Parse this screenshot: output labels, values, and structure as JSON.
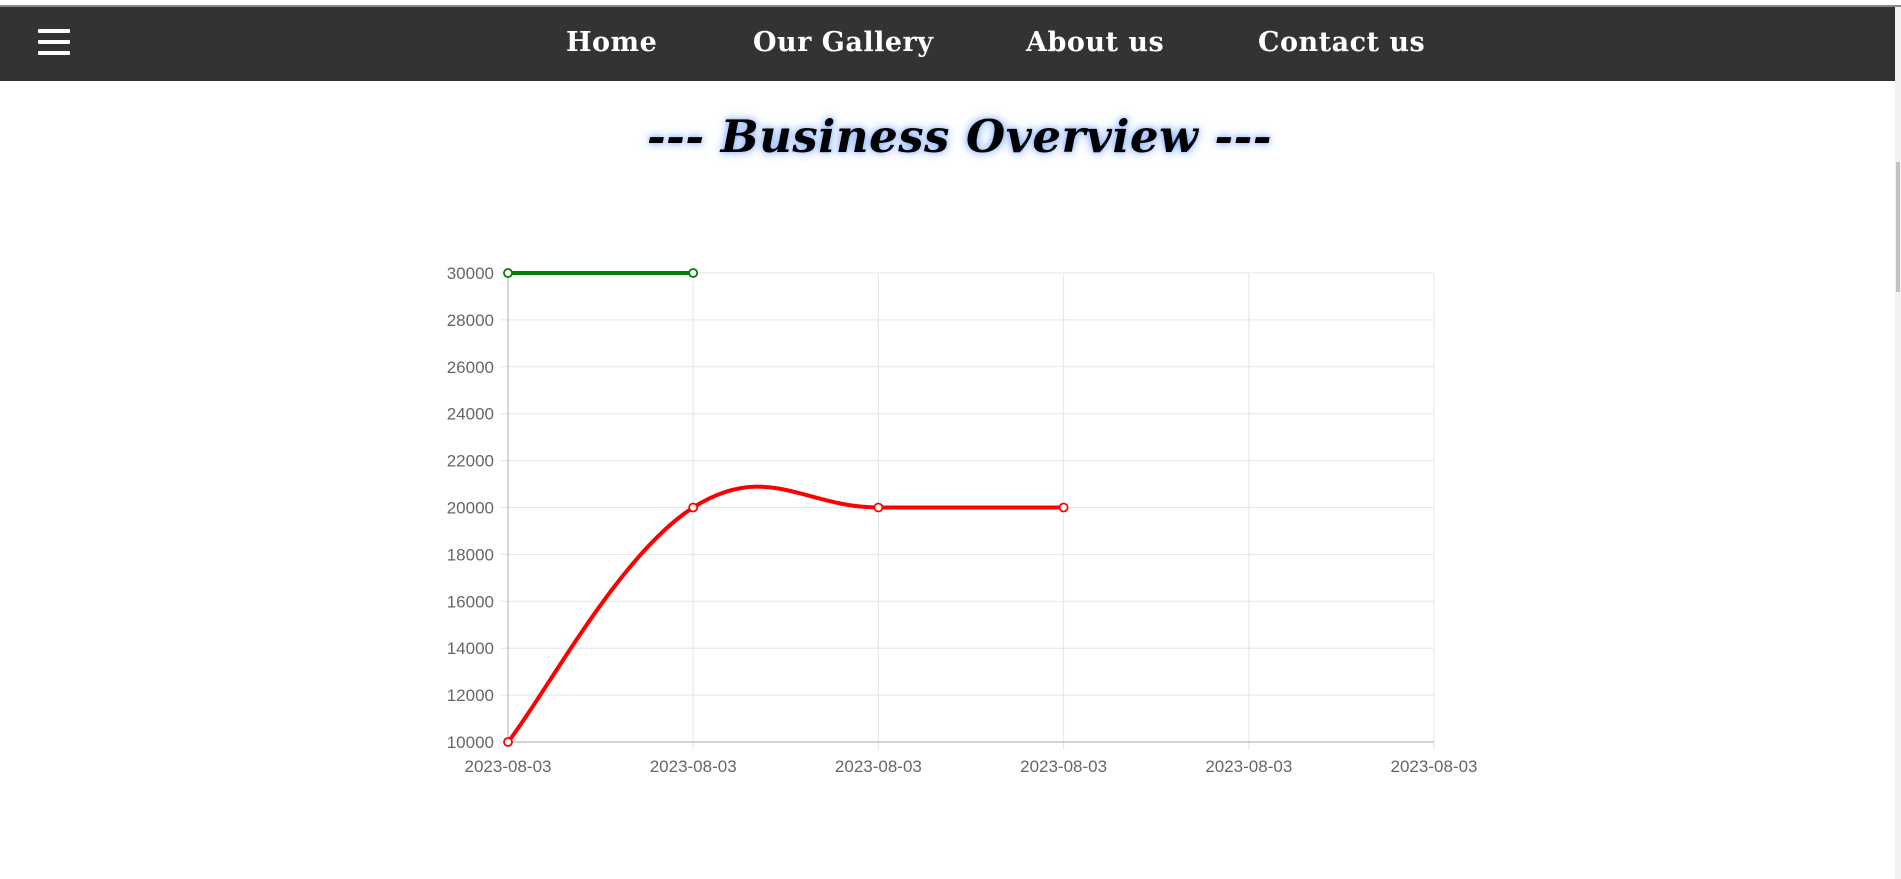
{
  "nav": {
    "menu_icon": "hamburger-menu-icon",
    "links": [
      "Home",
      "Our Gallery",
      "About us",
      "Contact us"
    ]
  },
  "page": {
    "title": "--- Business Overview ---"
  },
  "colors": {
    "navbar": "#333333",
    "series_green": "#008000",
    "series_red": "#ff0000",
    "grid": "#e5e5e5",
    "tick_text": "#666666"
  },
  "chart_data": {
    "type": "line",
    "title": "",
    "xlabel": "",
    "ylabel": "",
    "categories": [
      "2023-08-03",
      "2023-08-03",
      "2023-08-03",
      "2023-08-03",
      "2023-08-03",
      "2023-08-03"
    ],
    "ylim": [
      10000,
      30000
    ],
    "y_ticks": [
      30000,
      28000,
      26000,
      24000,
      22000,
      20000,
      18000,
      16000,
      14000,
      12000,
      10000
    ],
    "grid": true,
    "legend": "none",
    "series": [
      {
        "color": "#008000",
        "values": [
          30000,
          30000
        ]
      },
      {
        "color": "#ff0000",
        "values": [
          10000,
          20000,
          20000,
          20000
        ]
      }
    ]
  }
}
